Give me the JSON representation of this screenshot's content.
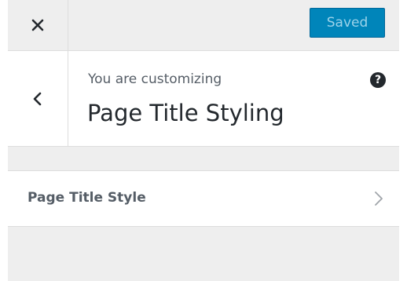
{
  "header": {
    "close_icon": "close-icon",
    "save_label": "Saved",
    "save_color": "#0085ba"
  },
  "info": {
    "back_icon": "chevron-left-icon",
    "customizing_label": "You are customizing",
    "title": "Page Title Styling",
    "help_icon": "help-icon",
    "help_glyph": "?"
  },
  "sections": [
    {
      "label": "Page Title Style",
      "icon": "chevron-right-icon"
    }
  ]
}
